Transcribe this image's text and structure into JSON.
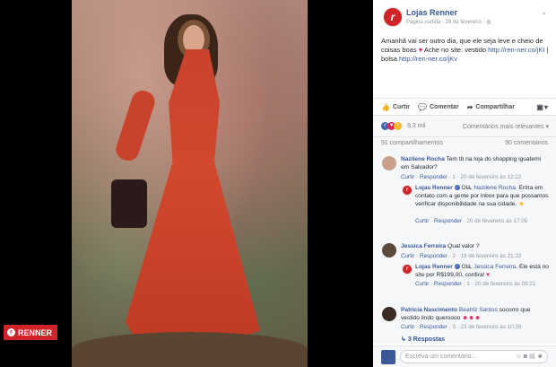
{
  "brand_badge": {
    "label": "RENNER",
    "icon": "renner-logo"
  },
  "post": {
    "page_name": "Lojas Renner",
    "page_meta": "Página curtida · 19 de fevereiro · ",
    "caption_text": "Amanhã vai ser outro dia, que ele seja leve e cheio de coisas boas ",
    "caption_text2": " Ache no site: vestido ",
    "link1": "http://ren-ner.co/jKI",
    "caption_text3": " | bolsa ",
    "link2": "http://ren-ner.co/jKv"
  },
  "actions": {
    "like": "Curtir",
    "comment": "Comentar",
    "share": "Compartilhar"
  },
  "reactions": {
    "count": "9,3 mil",
    "sort": "Comentários mais relevantes ▾"
  },
  "stats": {
    "shares": "91 compartilhamentos",
    "comments": "90 comentários"
  },
  "comments": [
    {
      "name": "Nazilene Rocha",
      "text": "Tem tb na loja do shopping iguatemi em Salvador?",
      "meta_like": "Curtir",
      "meta_reply": "Responder",
      "meta_rest": " · 1 · 20 de fevereiro às 12:22"
    },
    {
      "name": "Lojas Renner",
      "text_a": "Olá, ",
      "mention": "Nazilene Rocha",
      "text_b": ". Entra em contato com a gente por inbox para que possamos verificar disponibilidade na sua cidade. ",
      "meta_like": "Curtir",
      "meta_reply": "Responder",
      "meta_rest": " · 20 de fevereiro às 17:05"
    },
    {
      "name": "Jessica Ferreira",
      "text": "Qual valor ?",
      "meta_like": "Curtir",
      "meta_reply": "Responder",
      "meta_rest": " · 2 · 19 de fevereiro às 21:33"
    },
    {
      "name": "Lojas Renner",
      "text_a": "Olá, ",
      "mention": "Jessica Ferreira",
      "text_b": ". Ele está no site por R$199,00, confira! ",
      "meta_like": "Curtir",
      "meta_reply": "Responder",
      "meta_rest": " · 1 · 20 de fevereiro às 09:21"
    },
    {
      "name": "Patricia Nascimento",
      "mention": "Beatriz Santos",
      "text": " socorro que vestido lindo queroooo",
      "meta_like": "Curtir",
      "meta_reply": "Responder",
      "meta_rest": " · 3 · 23 de fevereiro às 10:26"
    }
  ],
  "more_replies": "3 Respostas",
  "compose": {
    "placeholder": "Escreva um comentário..."
  }
}
